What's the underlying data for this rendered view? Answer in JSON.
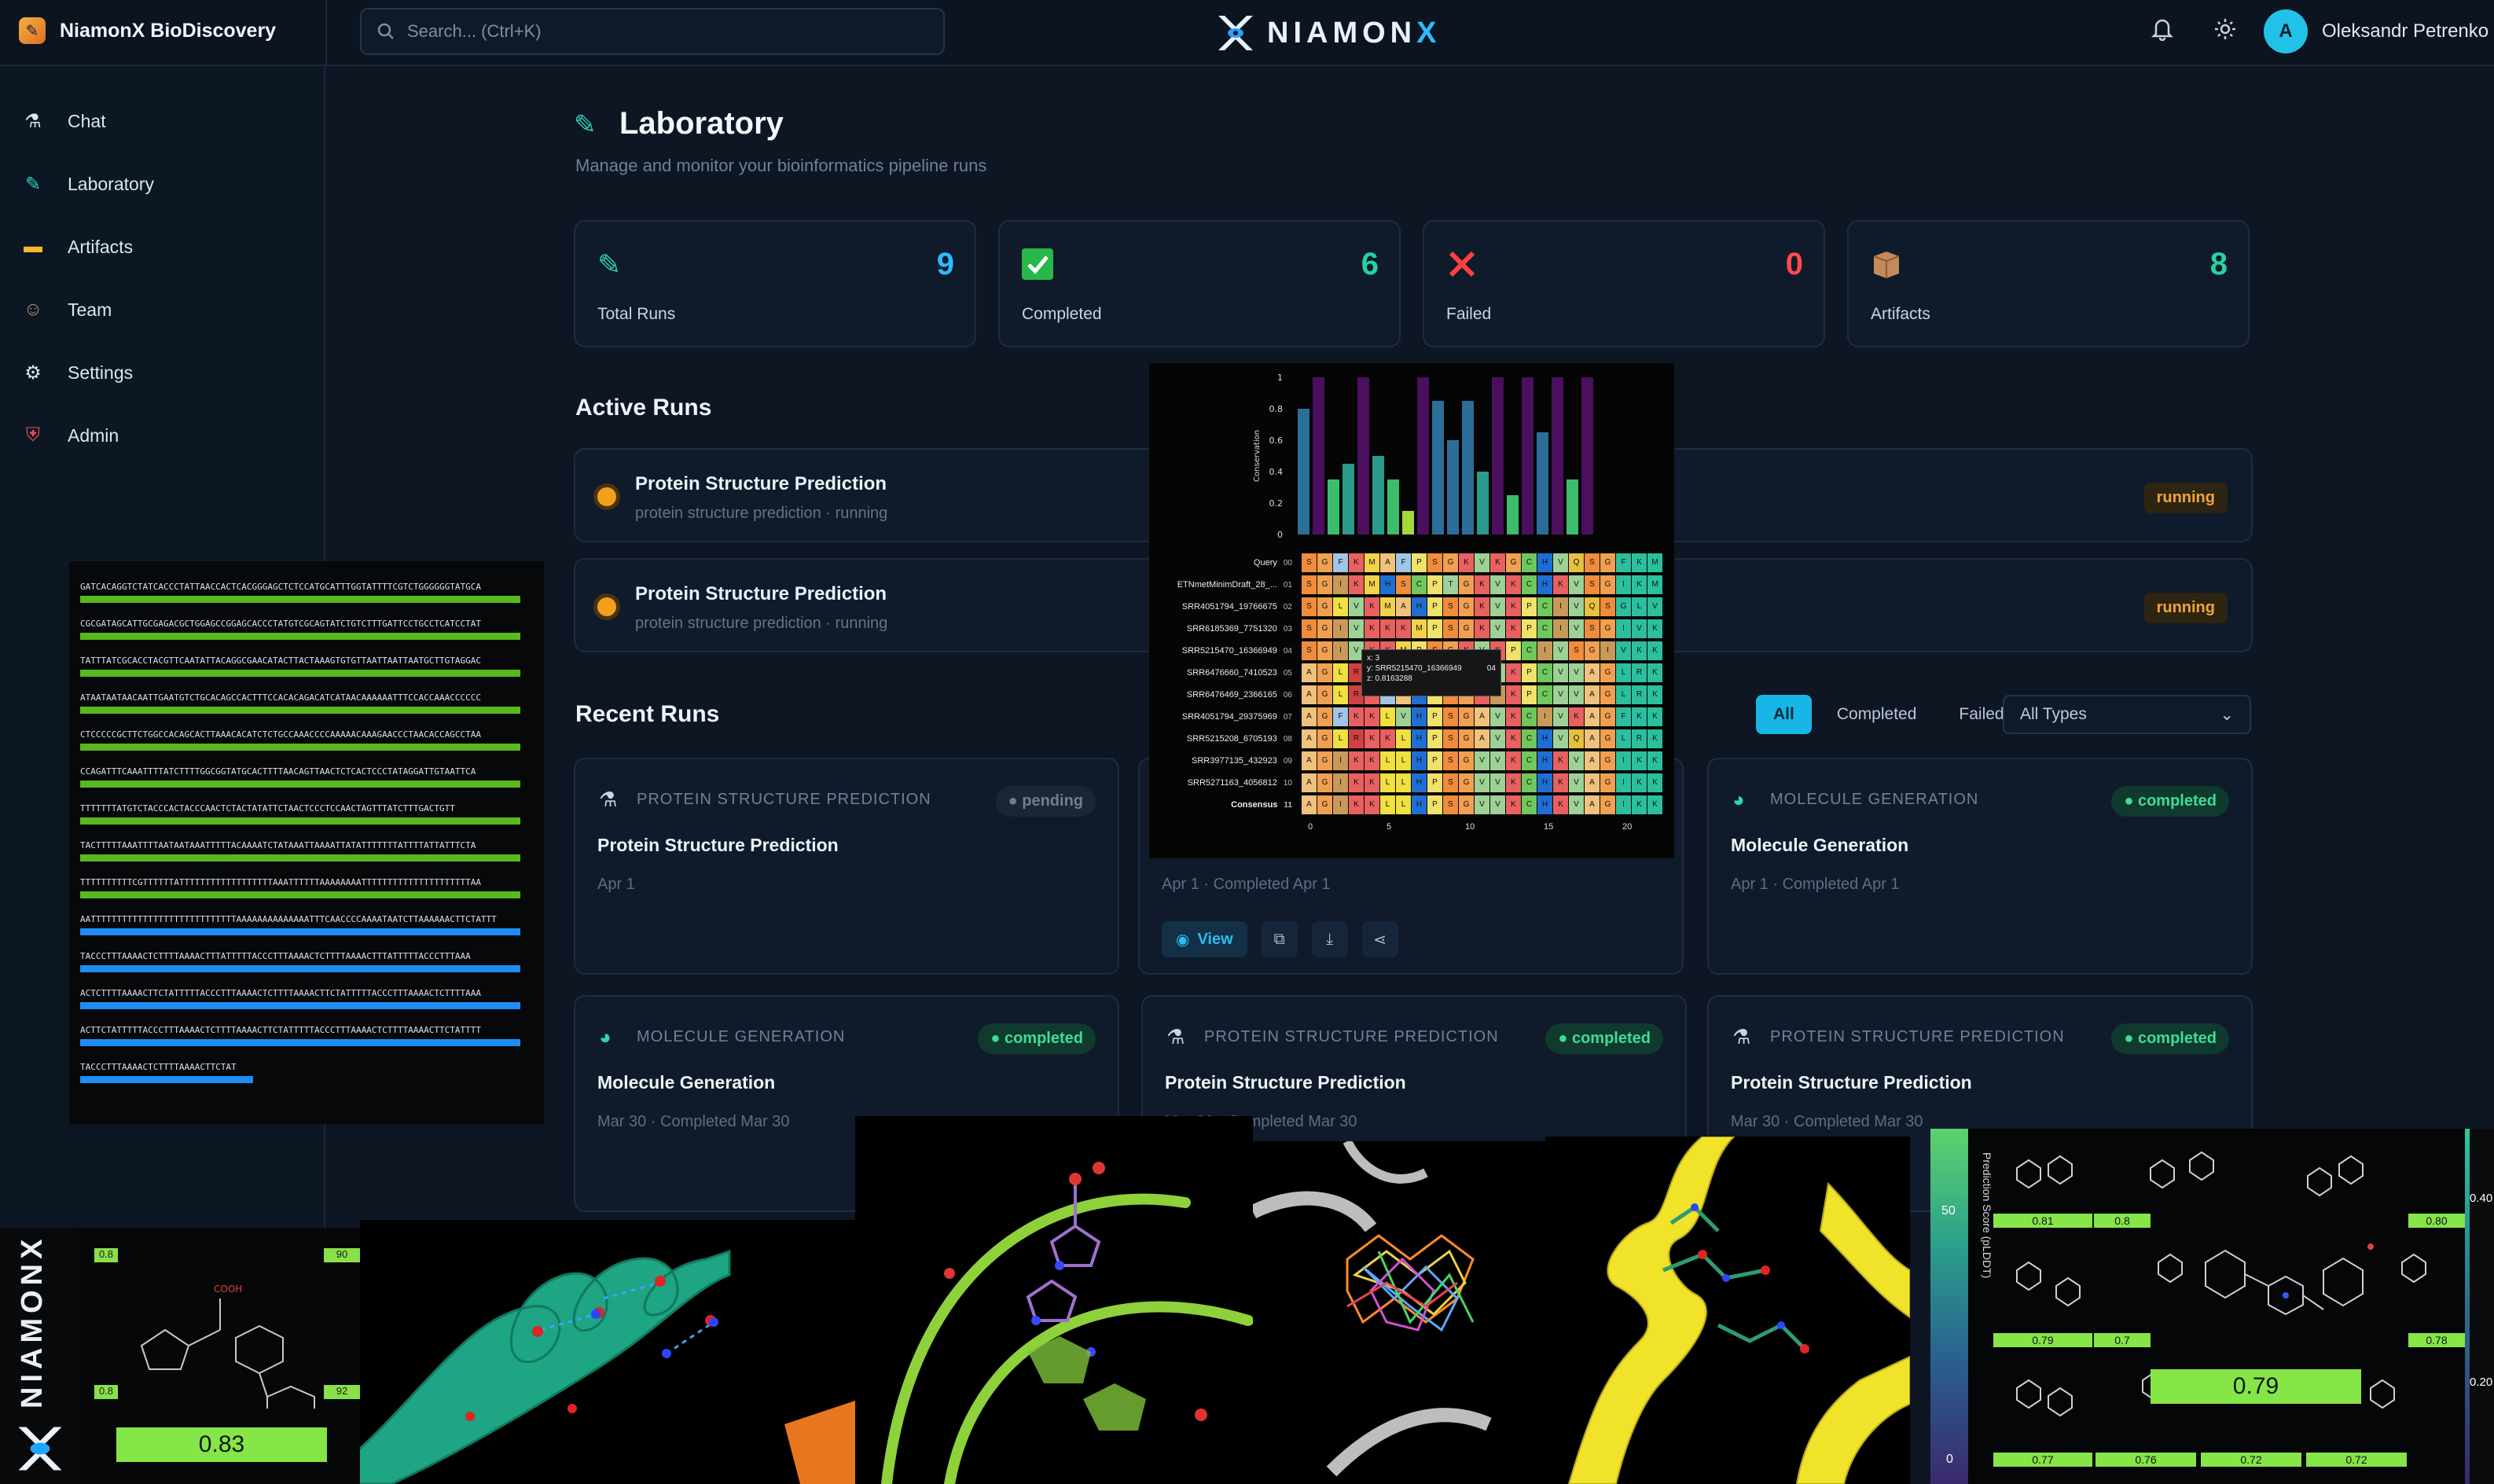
{
  "app": {
    "name": "NiamonX BioDiscovery",
    "logo_left": "NIAMON",
    "logo_right": "X"
  },
  "search": {
    "placeholder": "Search... (Ctrl+K)"
  },
  "user": {
    "initial": "A",
    "name": "Oleksandr Petrenko"
  },
  "sidebar": {
    "items": [
      {
        "label": "Chat",
        "icon": "chat-icon"
      },
      {
        "label": "Laboratory",
        "icon": "flask-icon"
      },
      {
        "label": "Artifacts",
        "icon": "folder-icon"
      },
      {
        "label": "Team",
        "icon": "team-icon"
      },
      {
        "label": "Settings",
        "icon": "gear-icon"
      },
      {
        "label": "Admin",
        "icon": "shield-icon"
      }
    ],
    "collapse": "«"
  },
  "page": {
    "title": "Laboratory",
    "subtitle": "Manage and monitor your bioinformatics pipeline runs"
  },
  "stats": [
    {
      "label": "Total Runs",
      "value": "9",
      "color": "#2bbcff",
      "icon": "pipette-icon"
    },
    {
      "label": "Completed",
      "value": "6",
      "color": "#25d3a2",
      "icon": "check-icon"
    },
    {
      "label": "Failed",
      "value": "0",
      "color": "#ff4b4b",
      "icon": "x-icon"
    },
    {
      "label": "Artifacts",
      "value": "8",
      "color": "#25d3a2",
      "icon": "box-icon"
    }
  ],
  "active": {
    "title": "Active Runs",
    "runs": [
      {
        "name": "Protein Structure Prediction",
        "sub": "protein structure prediction · running",
        "status": "running"
      },
      {
        "name": "Protein Structure Prediction",
        "sub": "protein structure prediction · running",
        "status": "running"
      }
    ]
  },
  "recent": {
    "title": "Recent Runs",
    "filters": [
      "All",
      "Completed",
      "Failed"
    ],
    "type_select": "All Types",
    "cards": [
      {
        "type": "PROTEIN STRUCTURE PREDICTION",
        "name": "Protein Structure Prediction",
        "date": "Apr 1",
        "status": "pending"
      },
      {
        "type": "",
        "name": "",
        "date": "Apr 1 · Completed Apr 1",
        "status": "",
        "view": "View"
      },
      {
        "type": "MOLECULE GENERATION",
        "name": "Molecule Generation",
        "date": "Apr 1 · Completed Apr 1",
        "status": "completed"
      },
      {
        "type": "MOLECULE GENERATION",
        "name": "Molecule Generation",
        "date": "Mar 30 · Completed Mar 30",
        "status": "completed"
      },
      {
        "type": "PROTEIN STRUCTURE PREDICTION",
        "name": "Protein Structure Prediction",
        "date": "Mar 30 · Completed Mar 30",
        "status": "completed"
      },
      {
        "type": "PROTEIN STRUCTURE PREDICTION",
        "name": "Protein Structure Prediction",
        "date": "Mar 30 · Completed Mar 30",
        "status": "completed"
      }
    ]
  },
  "msa": {
    "y_ticks": [
      "1",
      "0.8",
      "0.6",
      "0.4",
      "0.2",
      "0"
    ],
    "y_label": "Conservation",
    "conservation": [
      0.8,
      1.0,
      0.35,
      0.45,
      1.0,
      0.5,
      0.35,
      0.15,
      1.0,
      0.85,
      0.6,
      0.85,
      0.4,
      1.0,
      0.25,
      1.0,
      0.65,
      1.0,
      0.35,
      1.0
    ],
    "labels": [
      "Query",
      "ETNmetMinimDraft_28_...",
      "SRR4051794_19766675",
      "SRR6185369_7751320",
      "SRR5215470_16366949",
      "SRR6476660_7410523",
      "SRR6476469_2366165",
      "SRR4051794_29375969",
      "SRR5215208_6705193",
      "SRR3977135_432923",
      "SRR5271163_4056812",
      "Consensus"
    ],
    "row_index": [
      "00",
      "01",
      "02",
      "03",
      "04",
      "05",
      "06",
      "07",
      "08",
      "09",
      "10",
      "11"
    ],
    "seq": "SGFKMAFPSGKVKGCHVQ",
    "x_ticks": [
      "0",
      "5",
      "10",
      "15",
      "20"
    ],
    "tooltip": [
      "x: 3",
      "y: SRR5215470_16366949",
      "z: 0.8163288"
    ],
    "tooltip_val": "04"
  },
  "dna": {
    "lines": [
      "GATCACAGGTCTATCACCCTATTAACCACTCACGGGAGCTCTCCATGCATTTGGTATTTTCGTCTGGGGGGTATGCA",
      "CGCGATAGCATTGCGAGACGCTGGAGCCGGAGCACCCTATGTCGCAGTATCTGTCTTTGATTCCTGCCTCATCCTAT",
      "TATTTATCGCACCTACGTTCAATATTACAGGCGAACATACTTACTAAAGTGTGTTAATTAATTAATGCTTGTAGGAC",
      "ATAATAATAACAATTGAATGTCTGCACAGCCACTTTCCACACAGACATCATAACAAAAAATTTCCACCAAACCCCCC",
      "CTCCCCCGCTTCTGGCCACAGCACTTAAACACATCTCTGCCAAACCCCAAAAACAAAGAACCCTAACACCAGCCTAA",
      "CCAGATTTCAAATTTTATCTTTTGGCGGTATGCACTTTTAACAGTTAACTCTCACTCCCTATAGGATTGTAATTCA",
      "TTTTTTTATGTCTACCCACTACCCAACTCTACTATATTCTAACTCCCTCCAACTAGTTTATCTTTGACTGTT",
      "TACTTTTTAAATTTTAATAATAAATTTTTACAAAATCTATAAATTAAAATTATATTTTTTTATTTTATTATTTCTA",
      "TTTTTTTTTTCGTTTTTTATTTTTTTTTTTTTTTTTTAAATTTTTTAAAAAAAATTTTTTTTTTTTTTTTTTTTTAA",
      "AATTTTTTTTTTTTTTTTTTTTTTTTTTTTAAAAAAAAAAAAAATTTCAACCCCAAAATAATCTTAAAAAACTTCTATTT",
      "TACCCTTTAAAACTCTTTTAAAACTTTATTTTTACCCTTTAAAACTCTTTTAAAACTTTATTTTTACCCTTTAAA",
      "ACTCTTTTAAAACTTCTATTTTTACCCTTTAAAACTCTTTTAAAACTTCTATTTTTACCCTTTAAAACTCTTTTAAA",
      "ACTTCTATTTTTACCCTTTAAAACTCTTTTAAAACTTCTATTTTTACCCTTTAAAACTCTTTTAAAACTTCTATTTT",
      "TACCCTTTAAAACTCTTTTAAAACTTCTAT"
    ]
  },
  "grid": {
    "scores": [
      "0.81",
      "0.8",
      "0.80",
      "0.79",
      "0.7",
      "0.78",
      "0.79",
      "0.77",
      "0.76",
      "0.72",
      "0.72"
    ],
    "highlight": "0.79"
  },
  "leftmol": {
    "score": "0.83",
    "labels": [
      "0.8",
      "0.8",
      "90",
      "92"
    ],
    "brand": "NIAMONX"
  },
  "colorbar": {
    "label": "Prediction Score (pLDDT)",
    "ticks": [
      "50",
      "0"
    ],
    "right_ticks": [
      "0.40",
      "0.20"
    ]
  }
}
